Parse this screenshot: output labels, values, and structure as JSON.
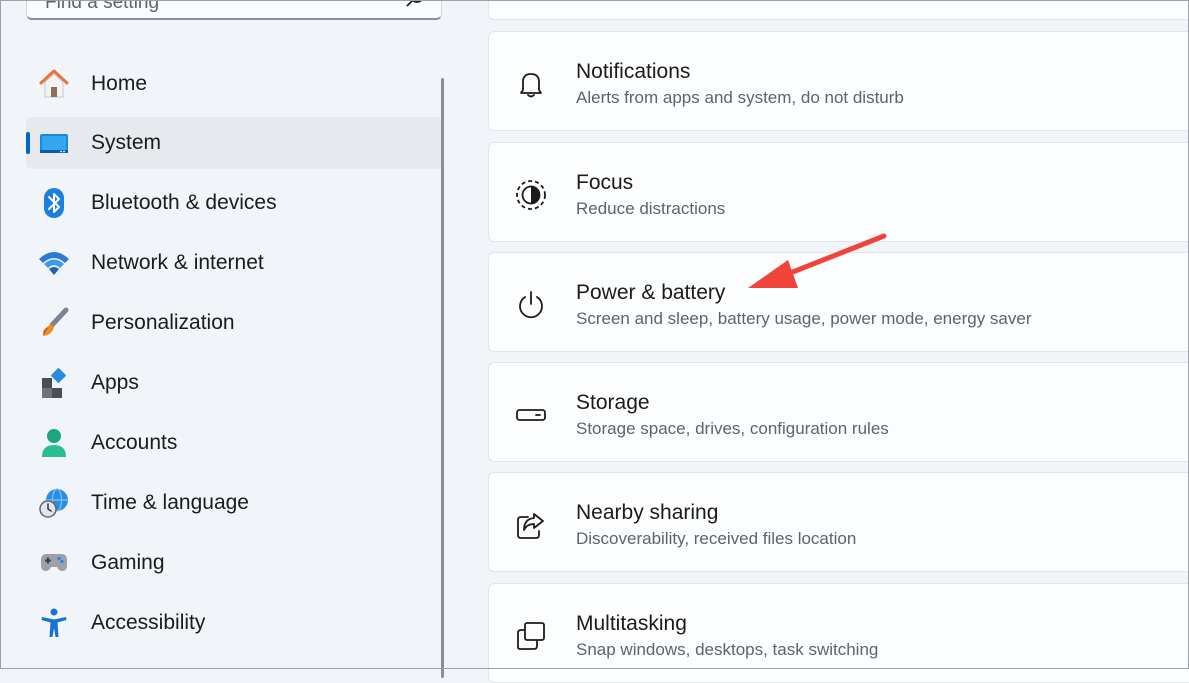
{
  "search": {
    "placeholder": "Find a setting"
  },
  "sidebar": {
    "items": [
      {
        "label": "Home",
        "icon": "home-icon"
      },
      {
        "label": "System",
        "icon": "monitor-icon",
        "selected": true
      },
      {
        "label": "Bluetooth & devices",
        "icon": "bluetooth-icon"
      },
      {
        "label": "Network & internet",
        "icon": "wifi-icon"
      },
      {
        "label": "Personalization",
        "icon": "paintbrush-icon"
      },
      {
        "label": "Apps",
        "icon": "apps-icon"
      },
      {
        "label": "Accounts",
        "icon": "person-icon"
      },
      {
        "label": "Time & language",
        "icon": "globe-clock-icon"
      },
      {
        "label": "Gaming",
        "icon": "gamepad-icon"
      },
      {
        "label": "Accessibility",
        "icon": "accessibility-icon"
      }
    ]
  },
  "settings": {
    "items": [
      {
        "title": "Notifications",
        "description": "Alerts from apps and system, do not disturb",
        "icon": "bell-icon"
      },
      {
        "title": "Focus",
        "description": "Reduce distractions",
        "icon": "focus-icon"
      },
      {
        "title": "Power & battery",
        "description": "Screen and sleep, battery usage, power mode, energy saver",
        "icon": "power-icon"
      },
      {
        "title": "Storage",
        "description": "Storage space, drives, configuration rules",
        "icon": "drive-icon"
      },
      {
        "title": "Nearby sharing",
        "description": "Discoverability, received files location",
        "icon": "share-icon"
      },
      {
        "title": "Multitasking",
        "description": "Snap windows, desktops, task switching",
        "icon": "multitasking-icon"
      }
    ]
  },
  "colors": {
    "accent": "#0067c0",
    "annotation": "#f0433a"
  }
}
